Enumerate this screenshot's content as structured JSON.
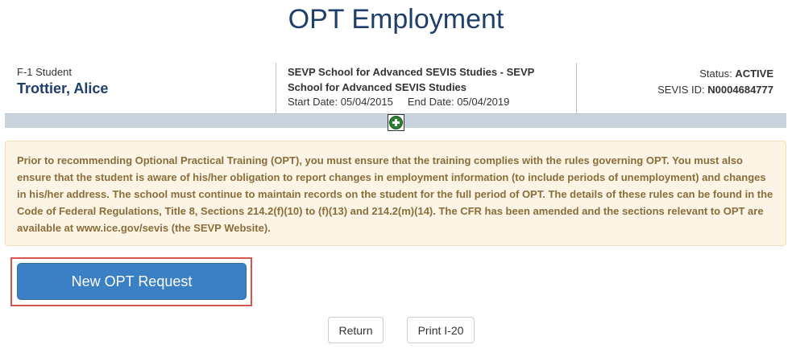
{
  "page": {
    "title": "OPT Employment"
  },
  "student": {
    "type": "F-1 Student",
    "name": "Trottier, Alice"
  },
  "school": {
    "name": "SEVP School for Advanced SEVIS Studies - SEVP School for Advanced SEVIS Studies",
    "start_label": "Start Date:",
    "start_date": "05/04/2015",
    "end_label": "End Date:",
    "end_date": "05/04/2019"
  },
  "status": {
    "status_label": "Status:",
    "status_value": "ACTIVE",
    "sevis_label": "SEVIS ID:",
    "sevis_value": "N0004684777"
  },
  "notice": {
    "text": "Prior to recommending Optional Practical Training (OPT), you must ensure that the training complies with the rules governing OPT. You must also ensure that the student is aware of his/her obligation to report changes in employment information (to include periods of unemployment) and changes in his/her address. The school must continue to maintain records on the student for the full period of OPT. The details of these rules can be found in the Code of Federal Regulations, Title 8, Sections 214.2(f)(10) to (f)(13) and 214.2(m)(14). The CFR has been amended and the sections relevant to OPT are available at www.ice.gov/sevis (the SEVP Website)."
  },
  "actions": {
    "new_opt_label": "New OPT Request",
    "return_label": "Return",
    "print_label": "Print I-20"
  },
  "icons": {
    "expand": "plus-circle-icon"
  },
  "colors": {
    "title": "#1f3f6b",
    "primary_button": "#3b7fc4",
    "highlight_frame": "#d9534f",
    "notice_bg": "#fcf4e4",
    "notice_text": "#8a6d3b",
    "expand_icon": "#2e7d32"
  }
}
